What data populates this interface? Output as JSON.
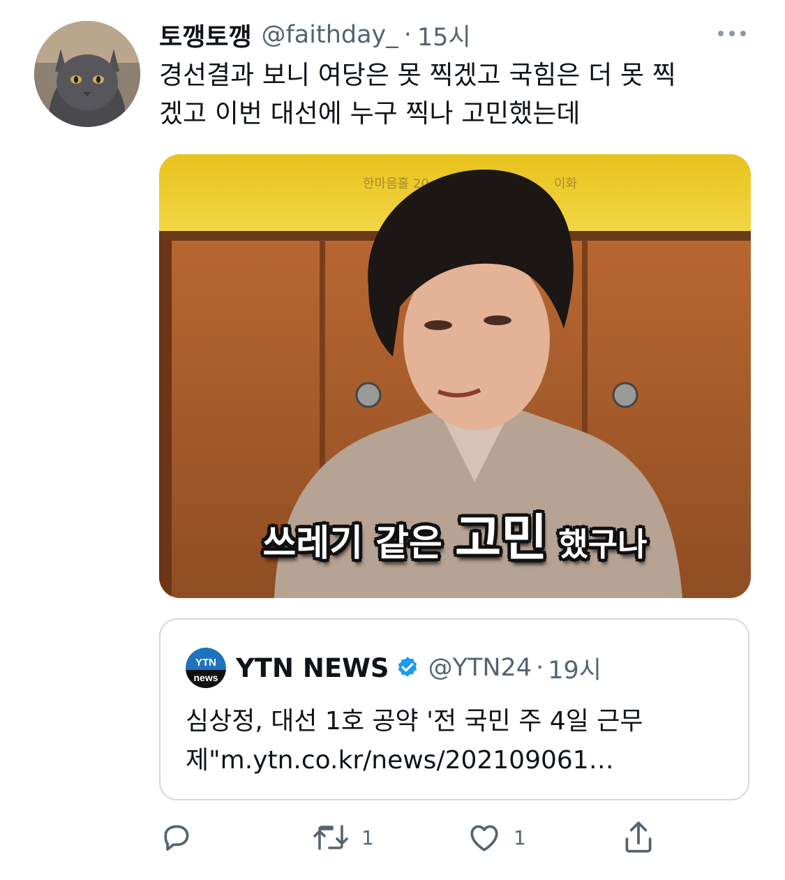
{
  "tweet": {
    "display_name": "토깽토깽",
    "handle": "@faithday_",
    "separator": "·",
    "time": "15시",
    "text_lines": [
      "경선결과 보니 여당은 못 찍겠고 국힘은 더 못 찍",
      "겠고 이번 대선에 누구 찍나 고민했는데"
    ],
    "more_icon": "more-dots-icon",
    "media": {
      "sign_text_left": "한마음홀 20",
      "sign_text_right": "이화",
      "caption_parts": [
        "쓰레기 같은 ",
        "고민",
        " 했구나"
      ]
    }
  },
  "quoted": {
    "logo_top": "YTN",
    "logo_bottom": "news",
    "display_name": "YTN NEWS",
    "verified_icon": "verified-badge-icon",
    "handle": "@YTN24",
    "separator": "·",
    "time": "19시",
    "text_lines": [
      "심상정, 대선 1호 공약 '전 국민 주 4일 근무",
      "제\"m.ytn.co.kr/news/202109061…"
    ]
  },
  "actions": {
    "reply": {
      "icon": "reply-icon",
      "count": ""
    },
    "retweet": {
      "icon": "retweet-icon",
      "count": "1"
    },
    "like": {
      "icon": "heart-icon",
      "count": "1"
    },
    "share": {
      "icon": "share-icon",
      "count": ""
    }
  },
  "colors": {
    "text": "#0f1419",
    "muted": "#536471",
    "border": "#cfd9de",
    "verified": "#1d9bf0",
    "ytn_blue": "#1e73be"
  }
}
